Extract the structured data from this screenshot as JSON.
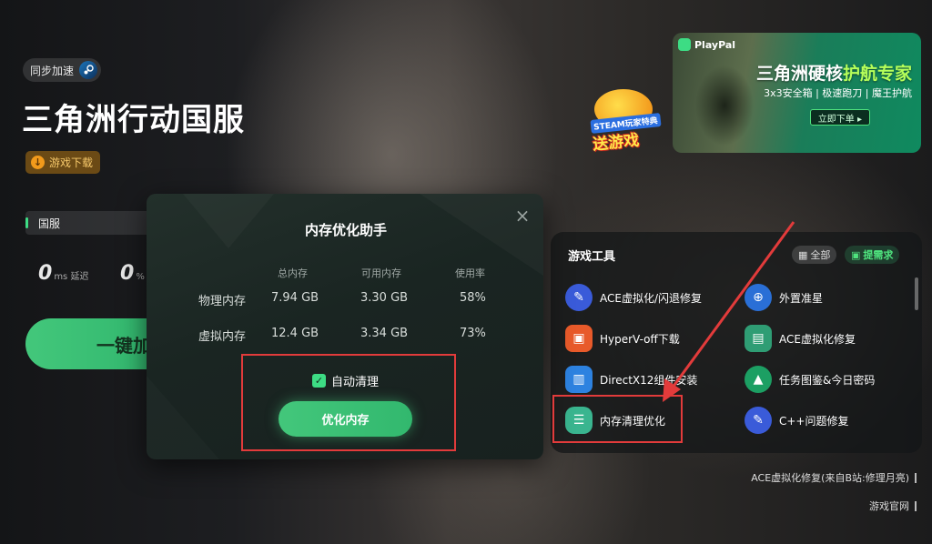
{
  "sidebar_game": {
    "sync_label": "同步加速",
    "title": "三角洲行动国服",
    "download_label": "游戏下载",
    "server": "国服",
    "stats": [
      {
        "value": "0",
        "unit": "ms 延迟"
      },
      {
        "value": "0",
        "unit": "%"
      }
    ],
    "boost_label": "一键加"
  },
  "ads": {
    "promo_line1": "STEAM玩家特典",
    "promo_line2": "送游戏",
    "banner_brand": "PlayPal",
    "banner_headline_a": "三角洲硬核",
    "banner_headline_b": "护航专家",
    "banner_sub": "3x3安全箱 | 极速跑刀 | 魔王护航",
    "banner_cta": "立即下单 ▸"
  },
  "tools": {
    "title": "游戏工具",
    "all_label": "全部",
    "request_label": "提需求",
    "items": [
      {
        "label": "ACE虚拟化/闪退修复",
        "icon": "wrench-icon",
        "color": "#3a5bd9"
      },
      {
        "label": "外置准星",
        "icon": "crosshair-icon",
        "color": "#2a6fd6"
      },
      {
        "label": "HyperV-off下载",
        "icon": "download-box-icon",
        "color": "#e85a2a"
      },
      {
        "label": "ACE虚拟化修复",
        "icon": "document-fix-icon",
        "color": "#2f9d74"
      },
      {
        "label": "DirectX12组件安装",
        "icon": "package-icon",
        "color": "#2d82e0"
      },
      {
        "label": "任务图鉴&今日密码",
        "icon": "mountain-icon",
        "color": "#1c9f63"
      },
      {
        "label": "内存清理优化",
        "icon": "memory-icon",
        "color": "#3ab58f"
      },
      {
        "label": "C++问题修复",
        "icon": "wrench-icon",
        "color": "#3a5bd9"
      }
    ],
    "footer_links": [
      "ACE虚拟化修复(来自B站:修理月亮)",
      "游戏官网"
    ]
  },
  "modal": {
    "title": "内存优化助手",
    "headers": [
      "总内存",
      "可用内存",
      "使用率"
    ],
    "rows": [
      {
        "label": "物理内存",
        "total": "7.94 GB",
        "available": "3.30 GB",
        "usage": "58%"
      },
      {
        "label": "虚拟内存",
        "total": "12.4 GB",
        "available": "3.34 GB",
        "usage": "73%"
      }
    ],
    "auto_clean_label": "自动清理",
    "auto_clean_checked": true,
    "optimize_label": "优化内存"
  },
  "colors": {
    "accent": "#3ddc84",
    "annotation": "#e23b3b"
  }
}
